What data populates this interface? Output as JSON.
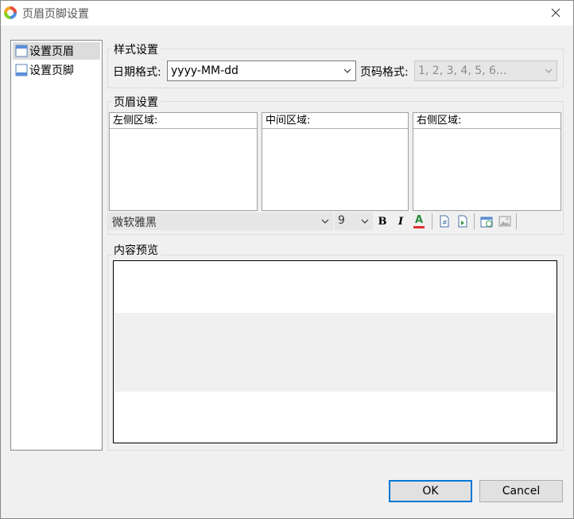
{
  "window": {
    "title": "页眉页脚设置"
  },
  "nav": {
    "items": [
      {
        "label": "设置页眉",
        "selected": true
      },
      {
        "label": "设置页脚",
        "selected": false
      }
    ]
  },
  "style_group": {
    "title": "样式设置",
    "date_format_label": "日期格式:",
    "date_format_value": "yyyy-MM-dd",
    "page_format_label": "页码格式:",
    "page_format_value": "1, 2, 3, 4, 5, 6..."
  },
  "header_group": {
    "title": "页眉设置",
    "left_area_label": "左侧区域:",
    "center_area_label": "中间区域:",
    "right_area_label": "右侧区域:"
  },
  "toolbar": {
    "font_name": "微软雅黑",
    "font_size": "9",
    "bold_glyph": "B",
    "italic_glyph": "I",
    "color_glyph": "A"
  },
  "preview_group": {
    "title": "内容预览"
  },
  "buttons": {
    "ok": "OK",
    "cancel": "Cancel"
  },
  "colors": {
    "accent": "#0078d7",
    "font_color_bar": "#e03030"
  }
}
